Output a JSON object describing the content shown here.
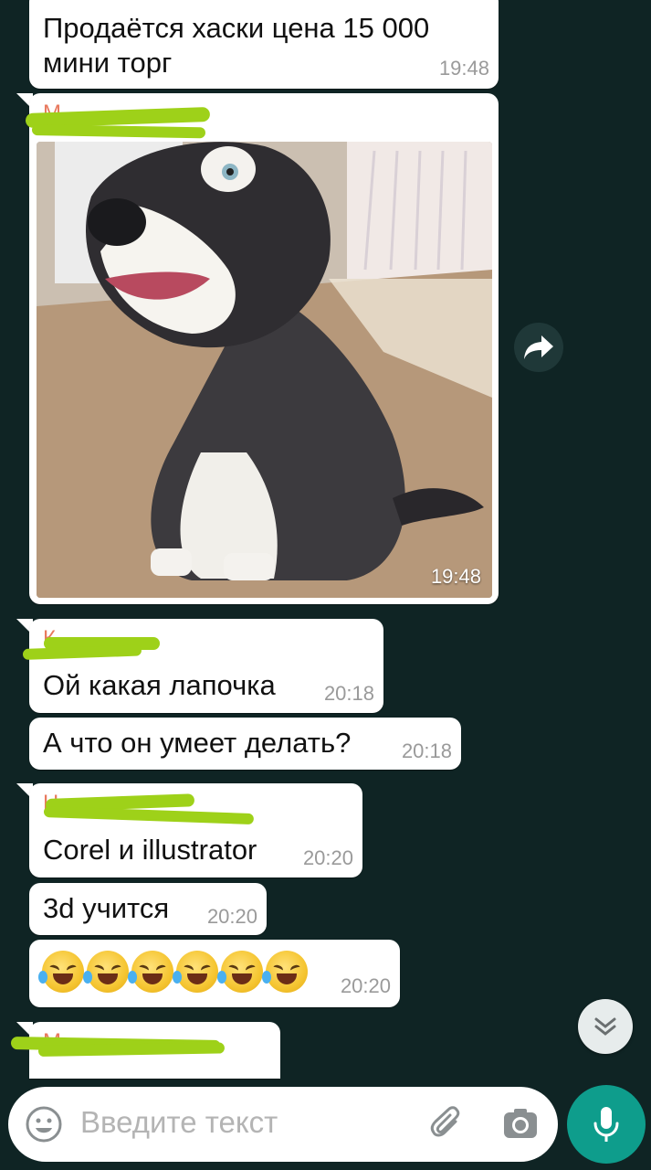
{
  "messages": [
    {
      "text_line1": "Продаётся хаски цена 15 000",
      "text_line2": "мини торг",
      "time": "19:48"
    },
    {
      "time": "19:48"
    },
    {
      "text": "Ой какая лапочка",
      "time": "20:18"
    },
    {
      "text": "А что он умеет делать?",
      "time": "20:18"
    },
    {
      "text": "Corel и illustrator",
      "time": "20:20"
    },
    {
      "text": "3d учится",
      "time": "20:20"
    },
    {
      "emoji": "rolling-on-floor-laughing",
      "emoji_count": 6,
      "time": "20:20"
    }
  ],
  "input": {
    "placeholder": "Введите текст"
  },
  "icons": {
    "forward": "forward-icon",
    "scroll_down": "double-chevron-down-icon",
    "emoji": "emoji-icon",
    "attach": "paperclip-icon",
    "camera": "camera-icon",
    "mic": "mic-icon"
  },
  "colors": {
    "background": "#0f2424",
    "bubble": "#ffffff",
    "accent": "#0e9d8c",
    "redaction": "#9ed119",
    "sender_name": "#e8795e"
  }
}
